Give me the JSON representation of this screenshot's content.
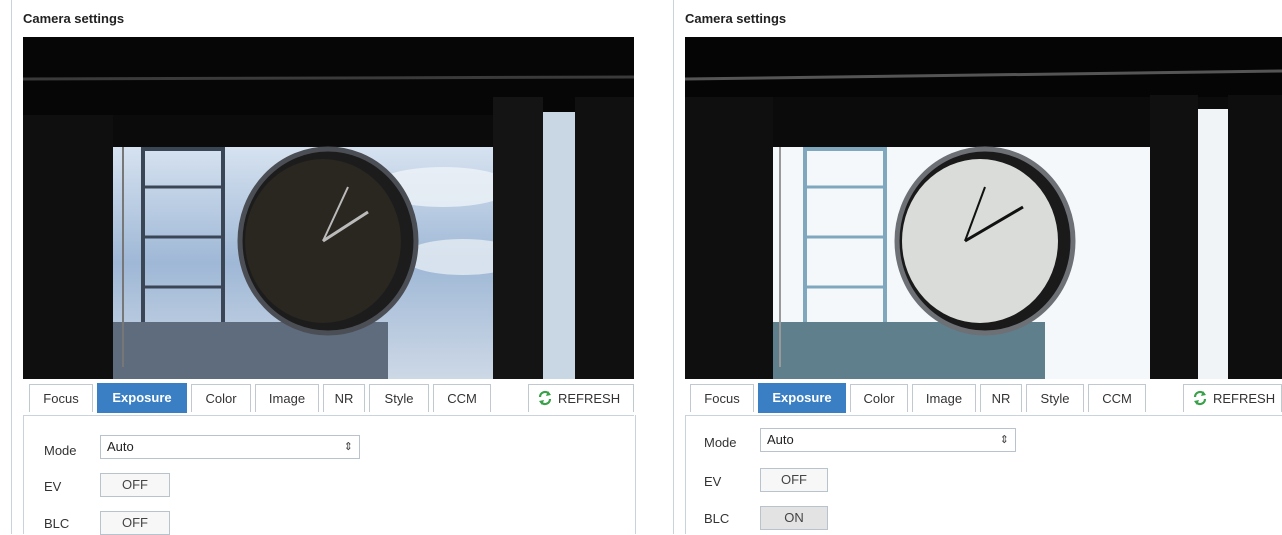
{
  "panels": [
    {
      "title": "Camera settings",
      "tabs": [
        "Focus",
        "Exposure",
        "Color",
        "Image",
        "NR",
        "Style",
        "CCM"
      ],
      "active_tab": "Exposure",
      "refresh_label": "REFRESH",
      "mode_label": "Mode",
      "mode_value": "Auto",
      "ev_label": "EV",
      "ev_value": "OFF",
      "blc_label": "BLC",
      "blc_value": "OFF"
    },
    {
      "title": "Camera settings",
      "tabs": [
        "Focus",
        "Exposure",
        "Color",
        "Image",
        "NR",
        "Style",
        "CCM"
      ],
      "active_tab": "Exposure",
      "refresh_label": "REFRESH",
      "mode_label": "Mode",
      "mode_value": "Auto",
      "ev_label": "EV",
      "ev_value": "OFF",
      "blc_label": "BLC",
      "blc_value": "ON"
    }
  ],
  "colors": {
    "accent": "#3a7fc3",
    "border": "#c9d3de",
    "refresh_icon": "#3aa04a"
  },
  "icons": {
    "refresh": "refresh-arrows-icon",
    "select": "updown-arrows-icon"
  }
}
